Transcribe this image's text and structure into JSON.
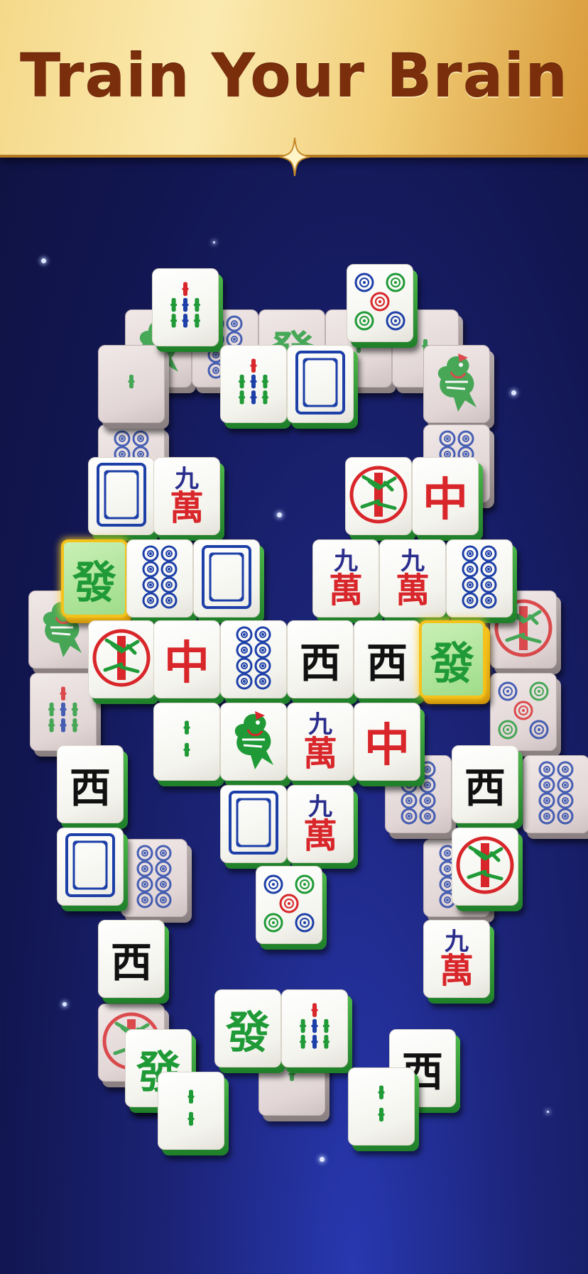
{
  "banner": {
    "title": "Train Your Brain"
  },
  "colors": {
    "banner_text": "#7a2e0c",
    "bamboo_green": "#1f9a36",
    "char_red": "#d8262a",
    "char_blue": "#2a2d8c",
    "selection_gold": "#f4c21a"
  },
  "tile_glyphs": {
    "fa": "發",
    "zhong": "中",
    "xi": "西",
    "jiu": "九",
    "wan": "萬"
  },
  "tiles": [
    {
      "id": "t-dim-1",
      "kind": "bird",
      "state": "dim"
    },
    {
      "id": "t-dim-2",
      "kind": "dot",
      "state": "dim"
    },
    {
      "id": "t-dim-3",
      "kind": "fa",
      "state": "dim"
    },
    {
      "id": "t-dim-4",
      "kind": "bamboo1",
      "state": "dim"
    },
    {
      "id": "t-dim-5",
      "kind": "bamboo1",
      "state": "dim"
    },
    {
      "id": "t-dim-6",
      "kind": "bird",
      "state": "dim"
    },
    {
      "id": "t-dim-7",
      "kind": "dot",
      "state": "dim"
    },
    {
      "id": "t-dim-8",
      "kind": "dot",
      "state": "dim"
    },
    {
      "id": "t-dim-9",
      "kind": "bird",
      "state": "dim"
    },
    {
      "id": "t-dim-10",
      "kind": "circlebamboo",
      "state": "dim"
    },
    {
      "id": "t-dim-11",
      "kind": "bamboo1",
      "state": "dim"
    },
    {
      "id": "t-dim-12",
      "kind": "bamboo5",
      "state": "dim"
    },
    {
      "id": "t-dim-13",
      "kind": "dot5",
      "state": "dim"
    },
    {
      "id": "t-dim-14",
      "kind": "dots8",
      "state": "dim"
    },
    {
      "id": "t-dim-15",
      "kind": "dots8",
      "state": "dim"
    },
    {
      "id": "t-dim-16",
      "kind": "dots8",
      "state": "dim"
    },
    {
      "id": "t-dim-17",
      "kind": "dots8",
      "state": "dim"
    },
    {
      "id": "t-dim-18",
      "kind": "fa",
      "state": "dim"
    },
    {
      "id": "t-dim-19",
      "kind": "bamboo1",
      "state": "dim"
    },
    {
      "id": "t-dim-20",
      "kind": "circlebamboo",
      "state": "dim"
    },
    {
      "id": "t-top-1",
      "kind": "bamboo5",
      "state": "normal"
    },
    {
      "id": "t-top-2",
      "kind": "dot5",
      "state": "normal"
    },
    {
      "id": "t-top-3",
      "kind": "bamboo5",
      "state": "normal"
    },
    {
      "id": "t-top-4",
      "kind": "frame",
      "state": "normal"
    },
    {
      "id": "t-r1-1",
      "kind": "frame",
      "state": "normal"
    },
    {
      "id": "t-r1-2",
      "kind": "wan9",
      "state": "normal"
    },
    {
      "id": "t-r1-3",
      "kind": "circlebamboo",
      "state": "normal"
    },
    {
      "id": "t-r1-4",
      "kind": "zhong",
      "state": "normal"
    },
    {
      "id": "t-r2-1",
      "kind": "fa",
      "state": "selected"
    },
    {
      "id": "t-r2-2",
      "kind": "dots8",
      "state": "normal"
    },
    {
      "id": "t-r2-3",
      "kind": "frame",
      "state": "normal"
    },
    {
      "id": "t-r2-4",
      "kind": "wan9",
      "state": "normal"
    },
    {
      "id": "t-r2-5",
      "kind": "wan9",
      "state": "normal"
    },
    {
      "id": "t-r2-6",
      "kind": "dots8",
      "state": "normal"
    },
    {
      "id": "t-r3-1",
      "kind": "circlebamboo",
      "state": "normal"
    },
    {
      "id": "t-r3-2",
      "kind": "zhong",
      "state": "normal"
    },
    {
      "id": "t-r3-3",
      "kind": "dots8",
      "state": "normal"
    },
    {
      "id": "t-r3-4",
      "kind": "xi",
      "state": "normal"
    },
    {
      "id": "t-r3-5",
      "kind": "xi",
      "state": "normal"
    },
    {
      "id": "t-r3-6",
      "kind": "fa",
      "state": "selected"
    },
    {
      "id": "t-r4-1",
      "kind": "bamboo2",
      "state": "normal"
    },
    {
      "id": "t-r4-2",
      "kind": "bird",
      "state": "normal"
    },
    {
      "id": "t-r4-3",
      "kind": "wan9",
      "state": "normal"
    },
    {
      "id": "t-r4-4",
      "kind": "zhong",
      "state": "normal"
    },
    {
      "id": "t-side-1",
      "kind": "xi",
      "state": "normal"
    },
    {
      "id": "t-side-2",
      "kind": "xi",
      "state": "normal"
    },
    {
      "id": "t-r5-1",
      "kind": "frame",
      "state": "normal"
    },
    {
      "id": "t-r5-2",
      "kind": "wan9",
      "state": "normal"
    },
    {
      "id": "t-side-3",
      "kind": "frame",
      "state": "normal"
    },
    {
      "id": "t-side-4",
      "kind": "circlebamboo",
      "state": "normal"
    },
    {
      "id": "t-r6-1",
      "kind": "dot5",
      "state": "normal"
    },
    {
      "id": "t-side-5",
      "kind": "xi",
      "state": "normal"
    },
    {
      "id": "t-side-6",
      "kind": "wan9",
      "state": "normal"
    },
    {
      "id": "t-bot-1",
      "kind": "fa",
      "state": "normal"
    },
    {
      "id": "t-bot-2",
      "kind": "bamboo5",
      "state": "normal"
    },
    {
      "id": "t-bot-3",
      "kind": "fa",
      "state": "normal"
    },
    {
      "id": "t-bot-4",
      "kind": "xi",
      "state": "normal"
    },
    {
      "id": "t-bot-5",
      "kind": "bamboo2",
      "state": "normal"
    },
    {
      "id": "t-bot-6",
      "kind": "bamboo2",
      "state": "normal"
    }
  ]
}
